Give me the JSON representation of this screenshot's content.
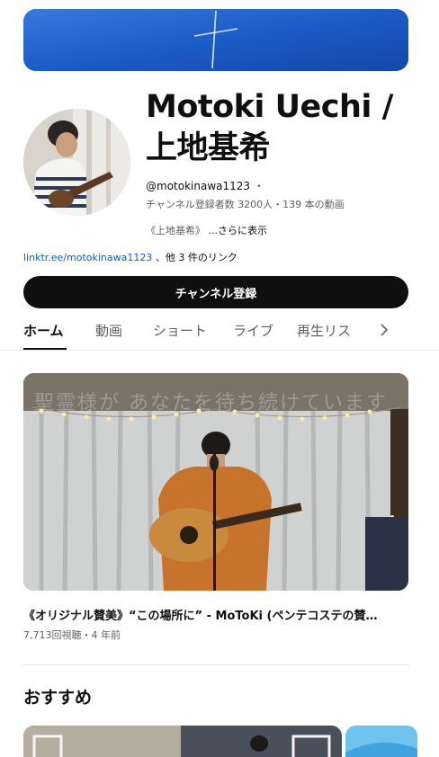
{
  "channel": {
    "name": "Motoki Uechi / 上地基希",
    "handle": "@motokinawa1123",
    "handle_sep": "・",
    "stats": "チャンネル登録者数 3200人・139 本の動画",
    "description": "《上地基希》",
    "more_label": "...さらに表示",
    "link_url": "linktr.ee/motokinawa1123",
    "link_more": "、他 3 件のリンク",
    "subscribe_label": "チャンネル登録"
  },
  "tabs": [
    {
      "label": "ホーム",
      "active": true
    },
    {
      "label": "動画"
    },
    {
      "label": "ショート"
    },
    {
      "label": "ライブ"
    },
    {
      "label": "再生リス"
    }
  ],
  "featured": {
    "overlay_text": "聖霊様が あなたを待ち続けています",
    "title": "《オリジナル賛美》“この場所に” - MoToKi (ペンテコステの賛…",
    "meta": "7,713回視聴・4 年前"
  },
  "sections": {
    "recommended_title": "おすすめ"
  },
  "colors": {
    "accent_link": "#065fd4",
    "subscribe_bg": "#0f0f0f",
    "secondary_text": "#606060"
  },
  "icons": {
    "tabs_next": "chevron-right-icon"
  }
}
